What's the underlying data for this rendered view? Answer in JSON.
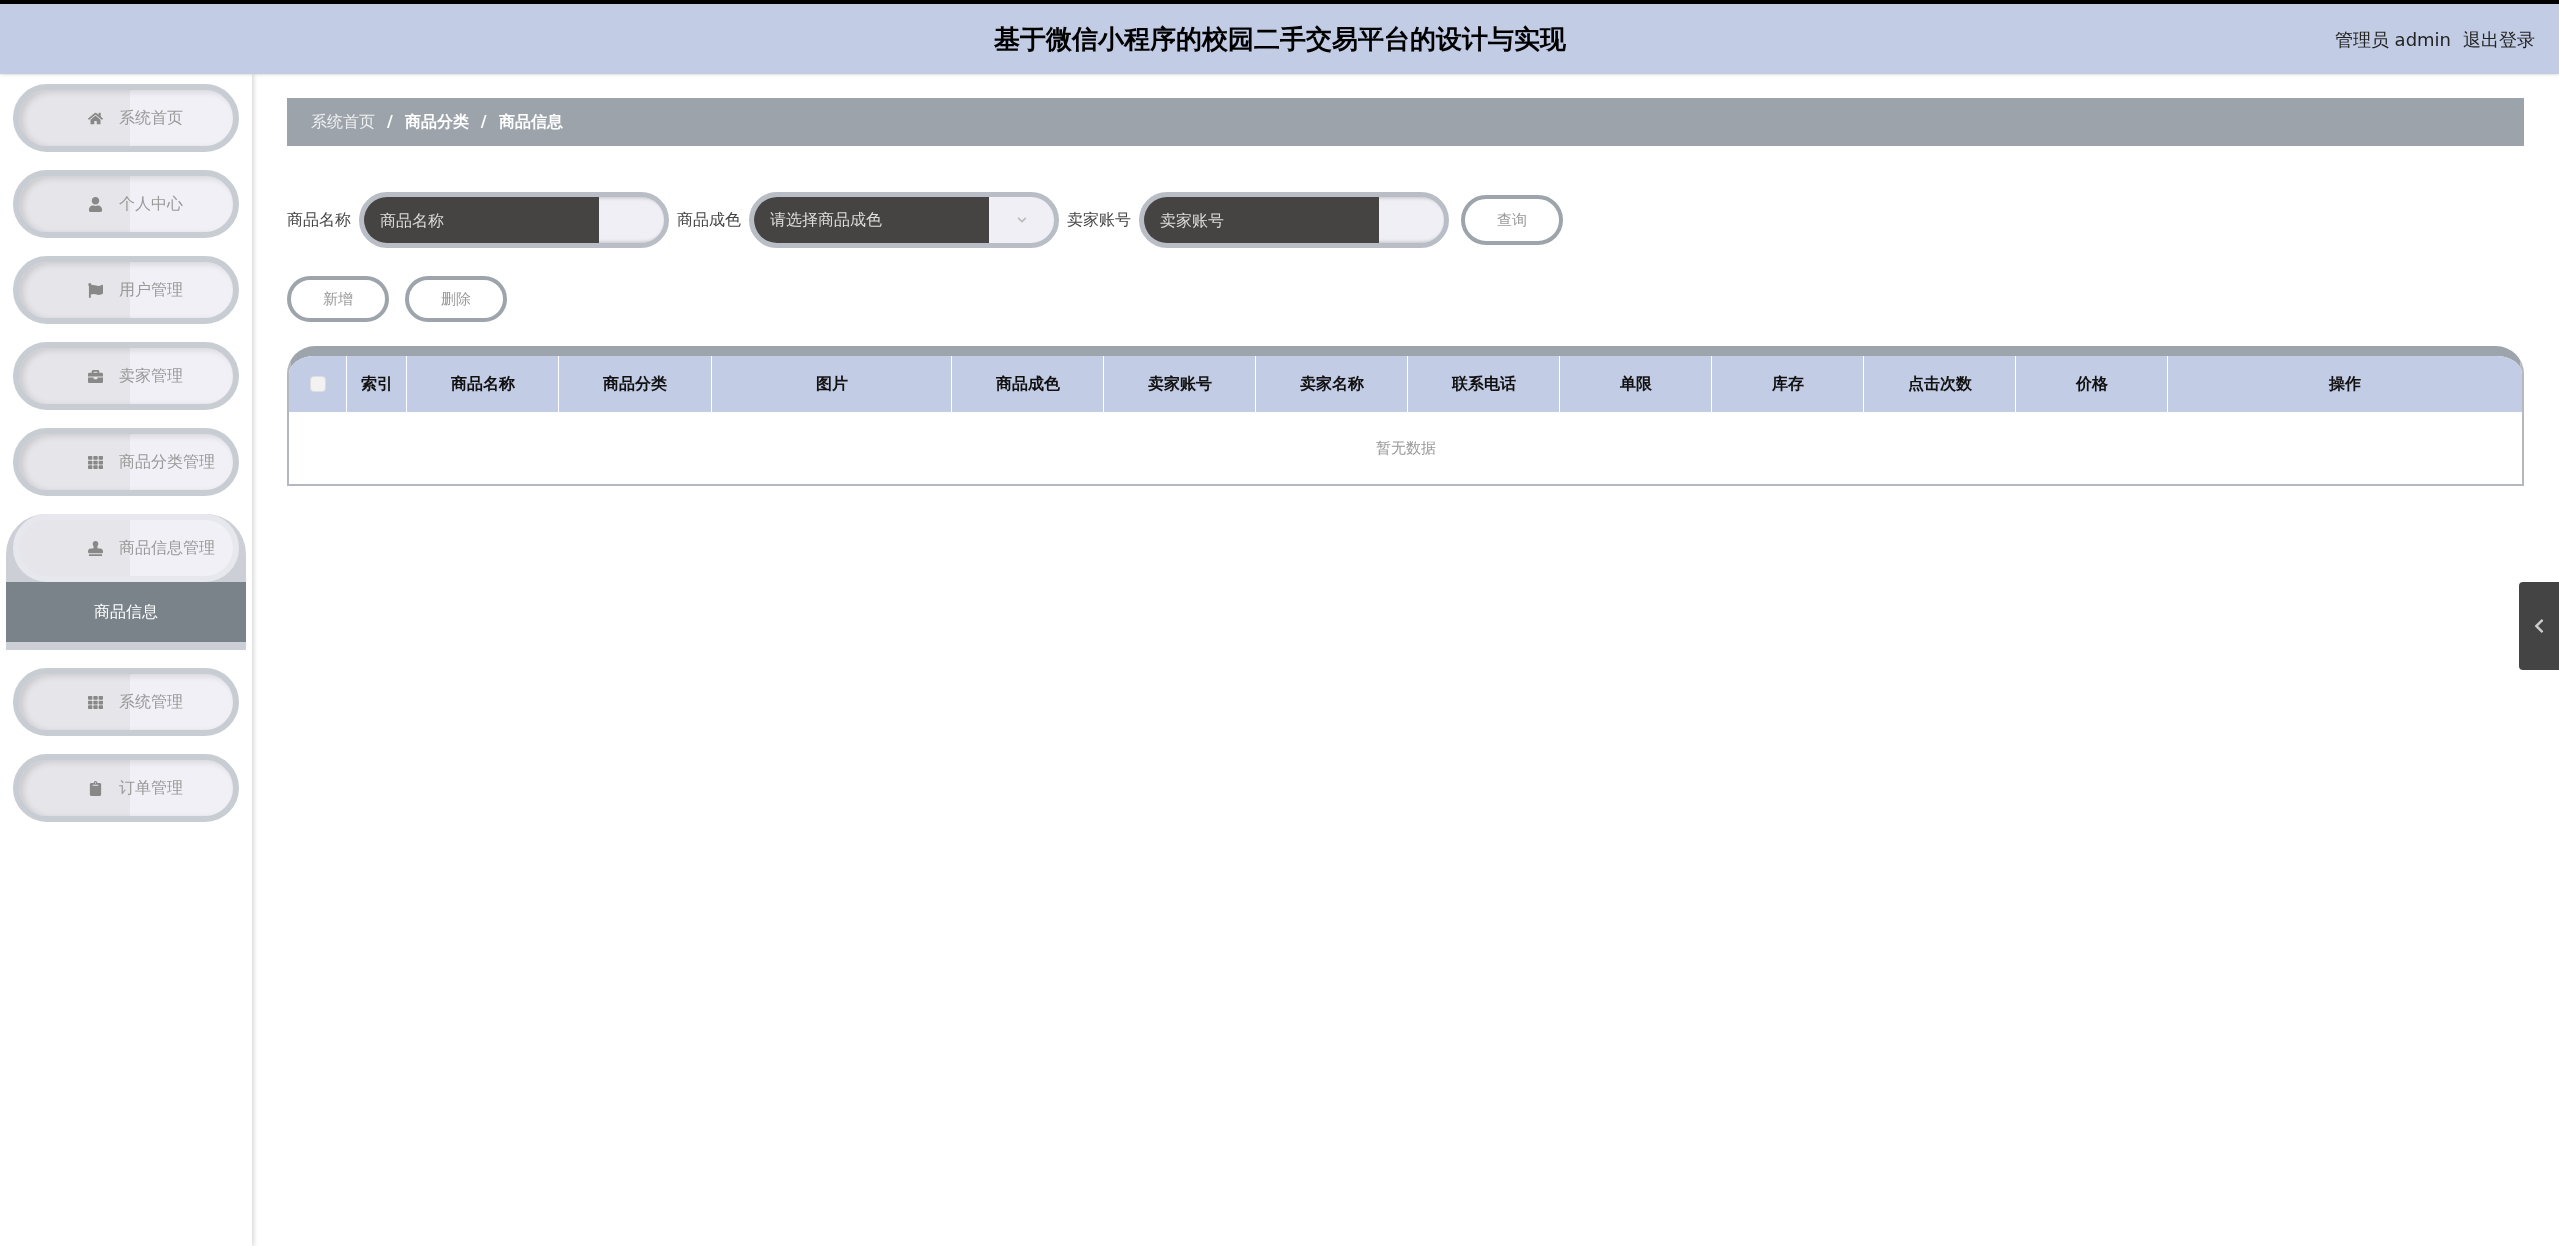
{
  "header": {
    "title": "基于微信小程序的校园二手交易平台的设计与实现",
    "user": "管理员 admin",
    "logout": "退出登录"
  },
  "sidebar": {
    "items": [
      {
        "label": "系统首页",
        "expanded": false
      },
      {
        "label": "个人中心",
        "expanded": false
      },
      {
        "label": "用户管理",
        "expanded": false
      },
      {
        "label": "卖家管理",
        "expanded": false
      },
      {
        "label": "商品分类管理",
        "expanded": false
      },
      {
        "label": "商品信息管理",
        "expanded": true,
        "children": [
          {
            "label": "商品信息",
            "selected": true
          }
        ]
      },
      {
        "label": "系统管理",
        "expanded": false
      },
      {
        "label": "订单管理",
        "expanded": false
      }
    ]
  },
  "breadcrumb": [
    {
      "kind": "link",
      "text": "系统首页"
    },
    {
      "kind": "separator",
      "text": "/"
    },
    {
      "kind": "link",
      "text": "商品分类"
    },
    {
      "kind": "separator",
      "text": "/"
    },
    {
      "kind": "link",
      "text": "商品信息"
    }
  ],
  "filters": [
    {
      "kind": "input",
      "label": "商品名称",
      "placeholder": "商品名称"
    },
    {
      "kind": "select",
      "label": "商品成色",
      "placeholder": "请选择商品成色"
    },
    {
      "kind": "input",
      "label": "卖家账号",
      "placeholder": "卖家账号"
    }
  ],
  "search_button": "查询",
  "actions": [
    "新增",
    "删除"
  ],
  "table": {
    "select_all": {
      "checked": false
    },
    "columns": [
      "索引",
      "商品名称",
      "商品分类",
      "图片",
      "商品成色",
      "卖家账号",
      "卖家名称",
      "联系电话",
      "单限",
      "库存",
      "点击次数",
      "价格",
      "操作"
    ],
    "empty_text": "暂无数据"
  }
}
